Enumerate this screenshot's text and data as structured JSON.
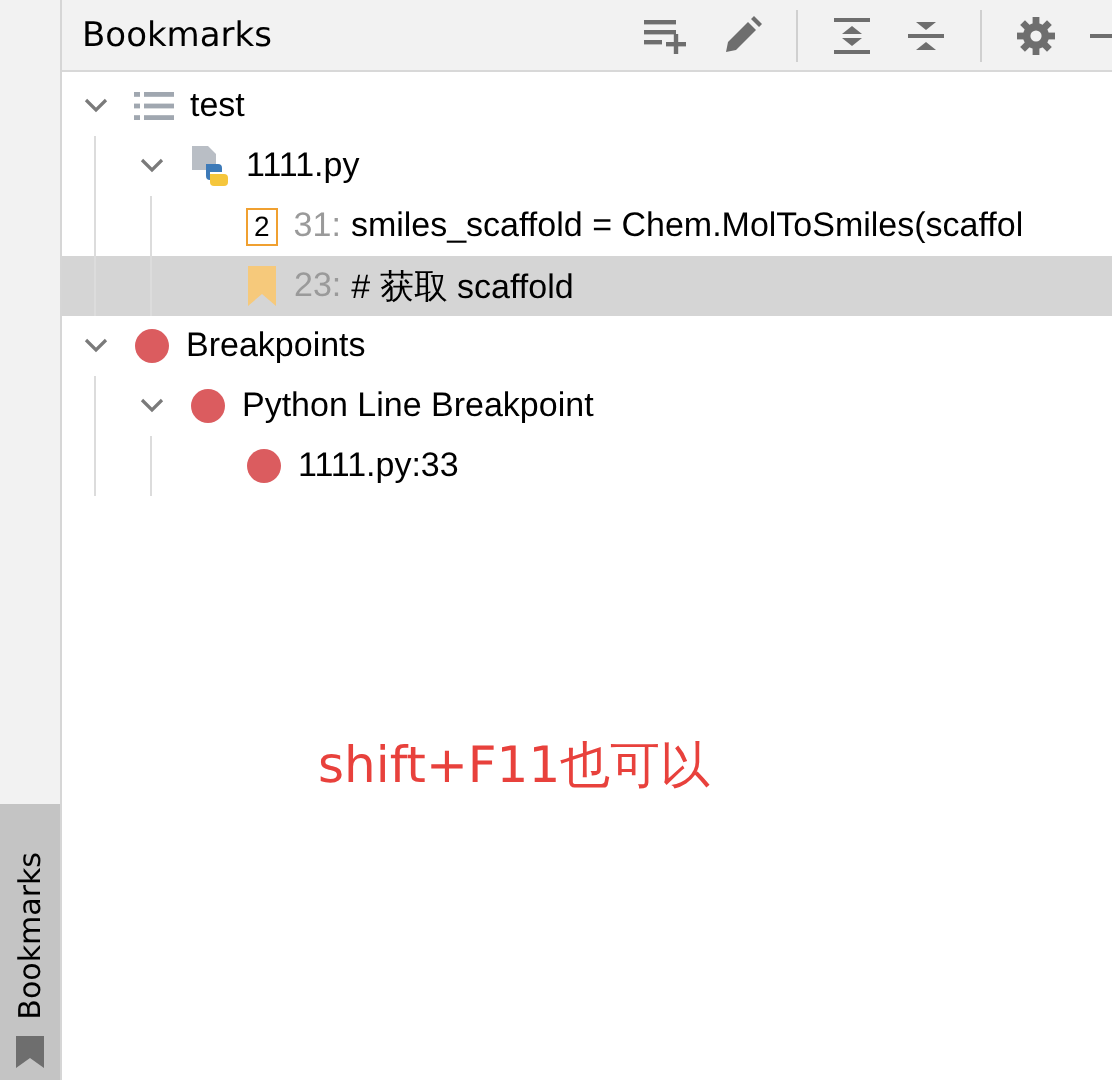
{
  "side_tab": {
    "label": "Bookmarks",
    "selected": true
  },
  "panel": {
    "title": "Bookmarks"
  },
  "tree": [
    {
      "kind": "list",
      "label": "test",
      "expanded": true,
      "selected": false,
      "children": [
        {
          "kind": "python-file",
          "label": "1111.py",
          "expanded": true,
          "selected": false,
          "children": [
            {
              "kind": "mnemonic",
              "mnemonic": "2",
              "line": "31:",
              "label": "smiles_scaffold = Chem.MolToSmiles(scaffol",
              "selected": false
            },
            {
              "kind": "bookmark",
              "line": "23:",
              "label": "# 获取 scaffold",
              "selected": true
            }
          ]
        }
      ]
    },
    {
      "kind": "breakpoint",
      "label": "Breakpoints",
      "expanded": true,
      "selected": false,
      "children": [
        {
          "kind": "breakpoint",
          "label": "Python Line Breakpoint",
          "expanded": true,
          "selected": false,
          "children": [
            {
              "kind": "breakpoint",
              "label": "1111.py:33",
              "selected": false
            }
          ]
        }
      ]
    }
  ],
  "annotation": "shift+F11也可以"
}
